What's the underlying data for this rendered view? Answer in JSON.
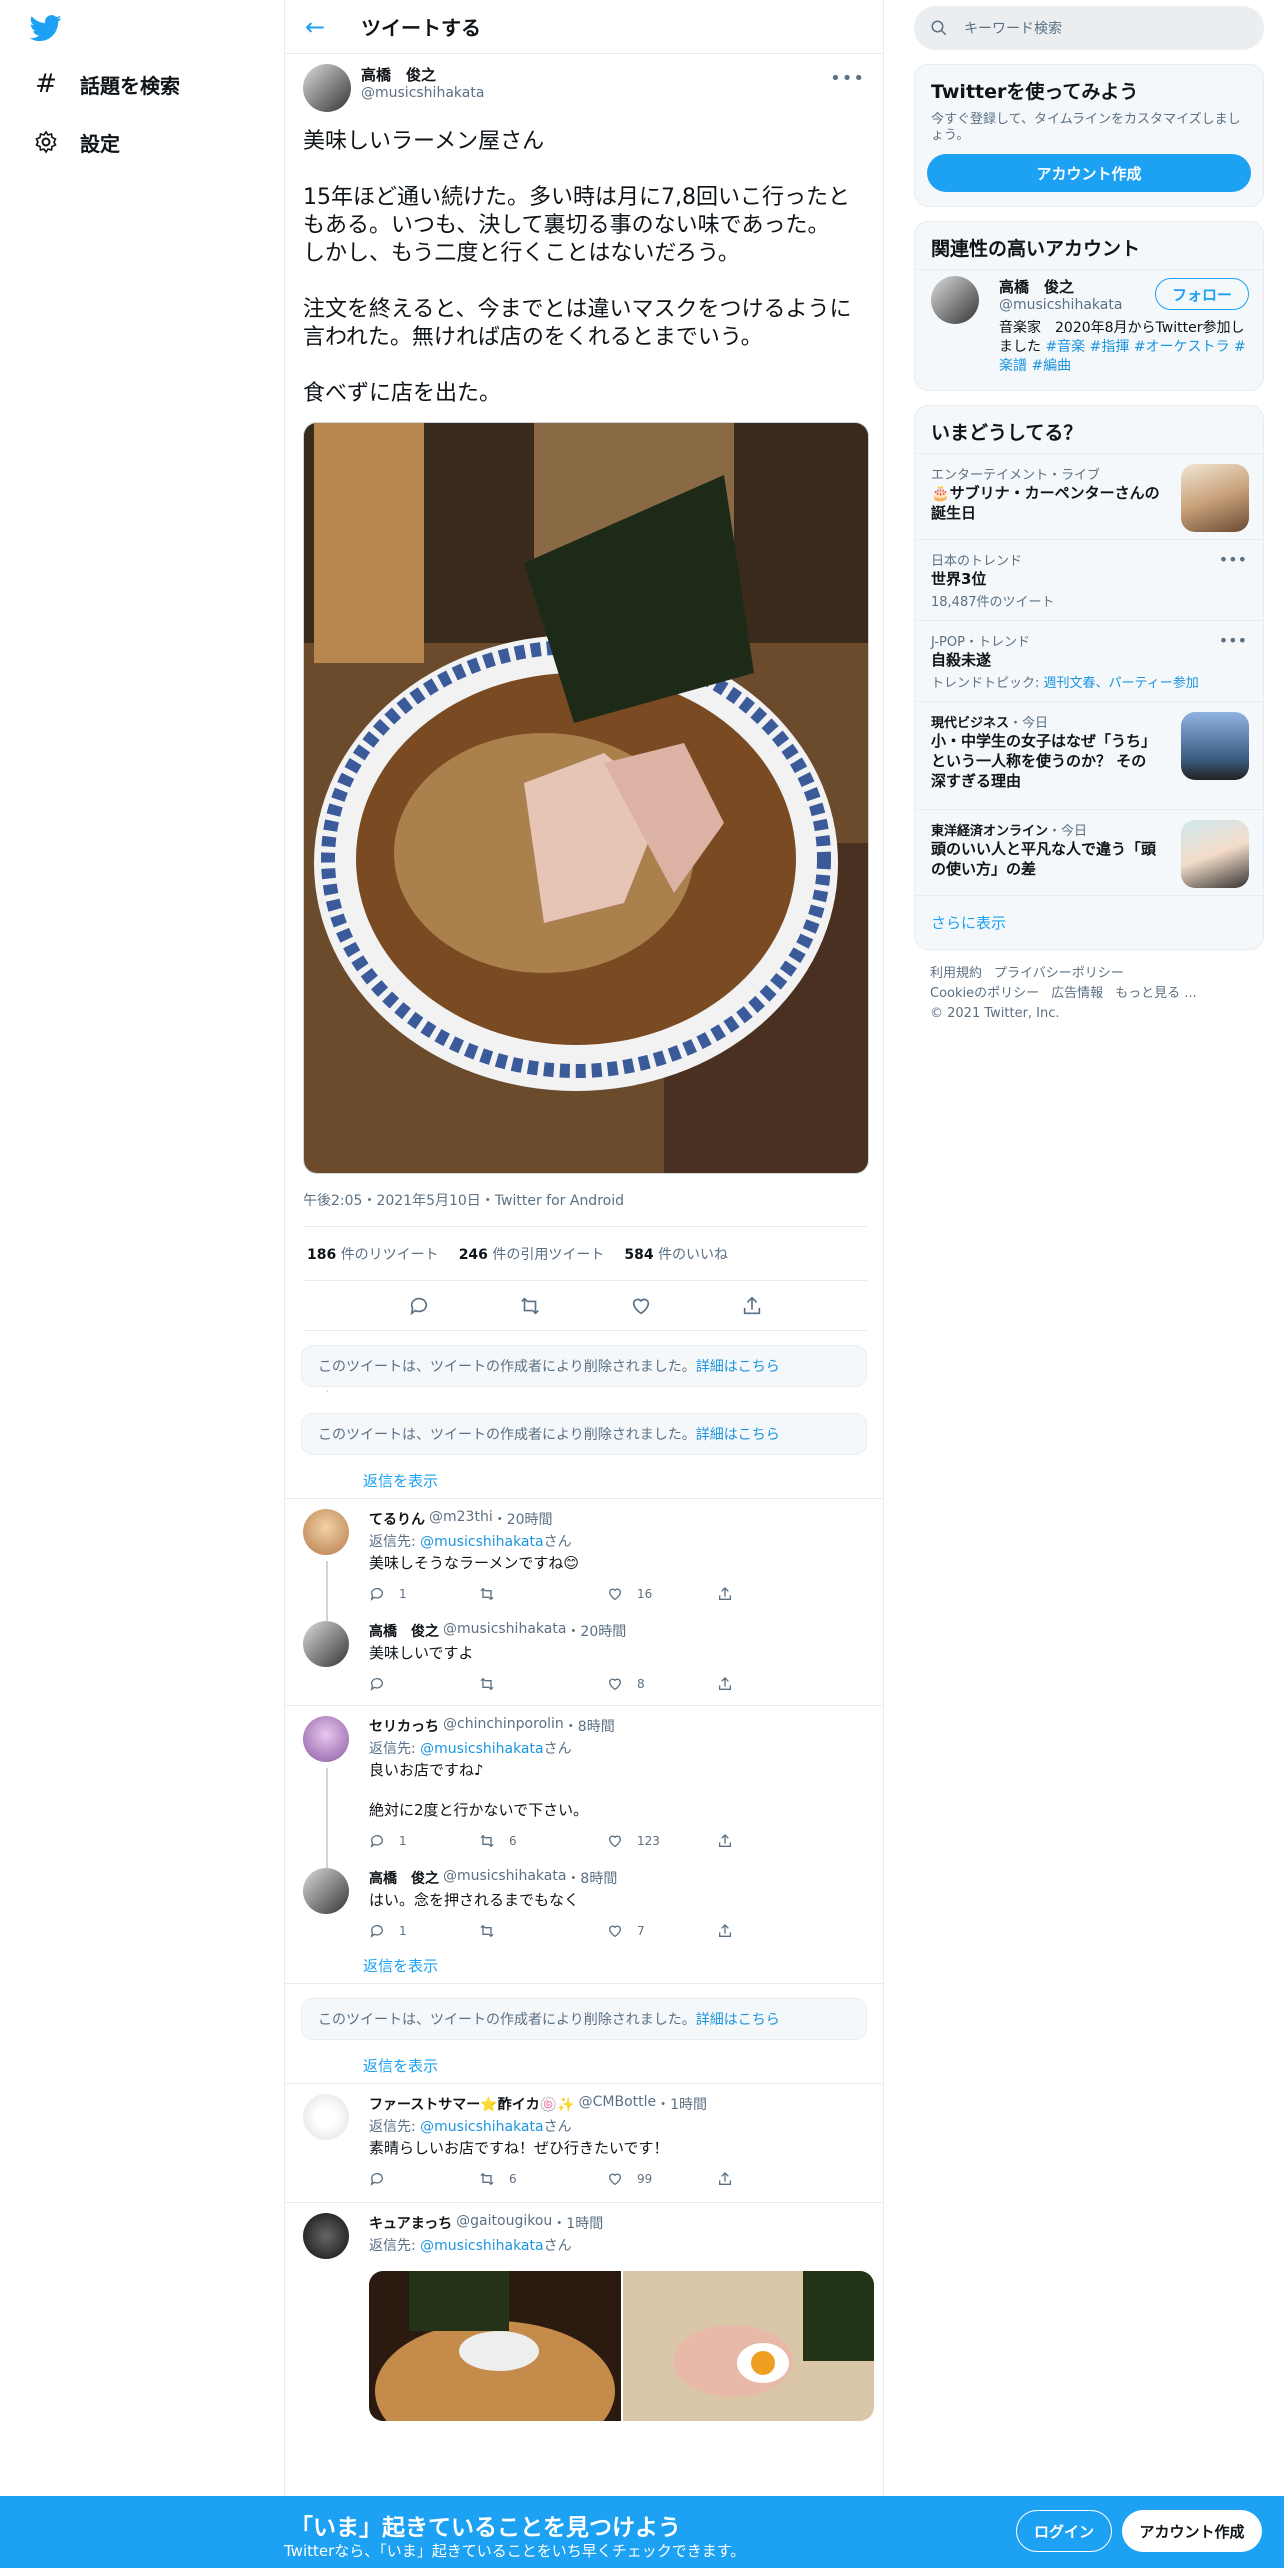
{
  "nav": {
    "explore": "話題を検索",
    "settings": "設定"
  },
  "header": {
    "title": "ツイートする"
  },
  "tweet": {
    "name": "高橋　俊之",
    "handle": "@musicshihakata",
    "text": "美味しいラーメン屋さん\n\n15年ほど通い続けた。多い時は月に7,8回いこ行ったともある。いつも、決して裏切る事のない味であった。\nしかし、もう二度と行くことはないだろう。\n\n注文を終えると、今までとは違いマスクをつけるように言われた。無ければ店のをくれるとまでいう。\n\n食べずに店を出た。",
    "meta": "午後2:05・2021年5月10日・Twitter for Android",
    "retweets": "186",
    "retweets_label": "件のリツイート",
    "quotes": "246",
    "quotes_label": "件の引用ツイート",
    "likes": "584",
    "likes_label": "件のいいね"
  },
  "deleted": {
    "text": "このツイートは、ツイートの作成者により削除されました。",
    "link": "詳細はこちら"
  },
  "show_replies": "返信を表示",
  "replies": [
    {
      "name": "てるりん",
      "handle": "@m23thi",
      "time": "・20時間",
      "to_label": "返信先: ",
      "to": "@musicshihakata",
      "to_suffix": "さん",
      "text": "美味しそうなラーメンですね😊",
      "reply": "1",
      "rt": "",
      "like": "16"
    },
    {
      "name": "高橋　俊之",
      "handle": "@musicshihakata",
      "time": "・20時間",
      "text": "美味しいですよ",
      "reply": "",
      "rt": "",
      "like": "8"
    },
    {
      "name": "セリカっち",
      "handle": "@chinchinporolin",
      "time": "・8時間",
      "to_label": "返信先: ",
      "to": "@musicshihakata",
      "to_suffix": "さん",
      "text": "良いお店ですね♪\n\n絶対に2度と行かないで下さい。",
      "reply": "1",
      "rt": "6",
      "like": "123"
    },
    {
      "name": "高橋　俊之",
      "handle": "@musicshihakata",
      "time": "・8時間",
      "text": "はい。念を押されるまでもなく",
      "reply": "1",
      "rt": "",
      "like": "7"
    },
    {
      "name": "ファーストサマー⭐酢イカ🍥✨",
      "handle": "@CMBottle",
      "time": "・1時間",
      "to_label": "返信先: ",
      "to": "@musicshihakata",
      "to_suffix": "さん",
      "text": "素晴らしいお店ですね！ぜひ行きたいです！",
      "reply": "",
      "rt": "6",
      "like": "99"
    },
    {
      "name": "キュアまっち",
      "handle": "@gaitougikou",
      "time": "・1時間",
      "to_label": "返信先: ",
      "to": "@musicshihakata",
      "to_suffix": "さん"
    }
  ],
  "right": {
    "search_placeholder": "キーワード検索",
    "join_title": "Twitterを使ってみよう",
    "join_sub": "今すぐ登録して、タイムラインをカスタマイズしましょう。",
    "join_btn": "アカウント作成",
    "related_title": "関連性の高いアカウント",
    "rel_name": "高橋　俊之",
    "rel_handle": "@musicshihakata",
    "follow": "フォロー",
    "rel_bio": "音楽家　2020年8月からTwitter参加しました ",
    "rel_tags": "#音楽 #指揮 #オーケストラ #楽譜 #編曲",
    "trends_title": "いまどうしてる？",
    "trends": [
      {
        "ctx": "エンターテイメント・ライブ",
        "title": "🎂サブリナ・カーペンターさんの誕生日"
      },
      {
        "ctx": "日本のトレンド",
        "title": "世界3位",
        "count": "18,487件のツイート"
      },
      {
        "ctx": "J-POP・トレンド",
        "title": "自殺未遂",
        "count_label": "トレンドトピック: ",
        "count_links": "週刊文春、パーティー参加"
      },
      {
        "ctx": "現代ビジネス",
        "ctx2": "・今日",
        "title": "小・中学生の女子はなぜ「うち」という一人称を使うのか？ その深すぎる理由"
      },
      {
        "ctx": "東洋経済オンライン",
        "ctx2": "・今日",
        "title": "頭のいい人と平凡な人で違う「頭の使い方」の差"
      }
    ],
    "see_more": "さらに表示",
    "footer": [
      "利用規約",
      "プライバシーポリシー",
      "Cookieのポリシー",
      "広告情報",
      "もっと見る ...",
      "© 2021 Twitter, Inc."
    ]
  },
  "bottom": {
    "title": "「いま」起きていることを見つけよう",
    "sub": "Twitterなら、「いま」起きていることをいち早くチェックできます。",
    "login": "ログイン",
    "signup": "アカウント作成"
  },
  "colors": {
    "accent": "#1da1f2",
    "border": "#e6ecf0",
    "muted": "#5b7083"
  }
}
